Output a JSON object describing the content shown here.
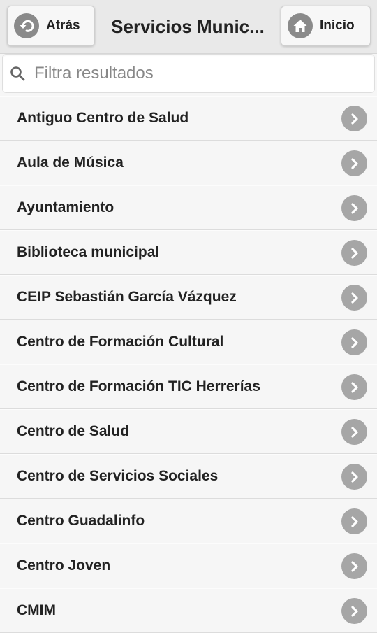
{
  "header": {
    "back_label": "Atrás",
    "title": "Servicios Munic...",
    "home_label": "Inicio"
  },
  "search": {
    "placeholder": "Filtra resultados",
    "value": ""
  },
  "items": [
    {
      "label": "Antiguo Centro de Salud"
    },
    {
      "label": "Aula de Música"
    },
    {
      "label": "Ayuntamiento"
    },
    {
      "label": "Biblioteca municipal"
    },
    {
      "label": "CEIP Sebastián García Vázquez"
    },
    {
      "label": "Centro de Formación Cultural"
    },
    {
      "label": "Centro de Formación TIC Herrerías"
    },
    {
      "label": "Centro de Salud"
    },
    {
      "label": "Centro de Servicios Sociales"
    },
    {
      "label": "Centro Guadalinfo"
    },
    {
      "label": "Centro Joven"
    },
    {
      "label": "CMIM"
    }
  ],
  "icons": {
    "back": "arrow-left-icon",
    "home": "home-icon",
    "search": "search-icon",
    "row": "chevron-right-icon"
  },
  "colors": {
    "header_bg": "#e9e9e9",
    "icon_bg": "#8a8a8a",
    "arrow_bg": "#a6a6a6"
  }
}
